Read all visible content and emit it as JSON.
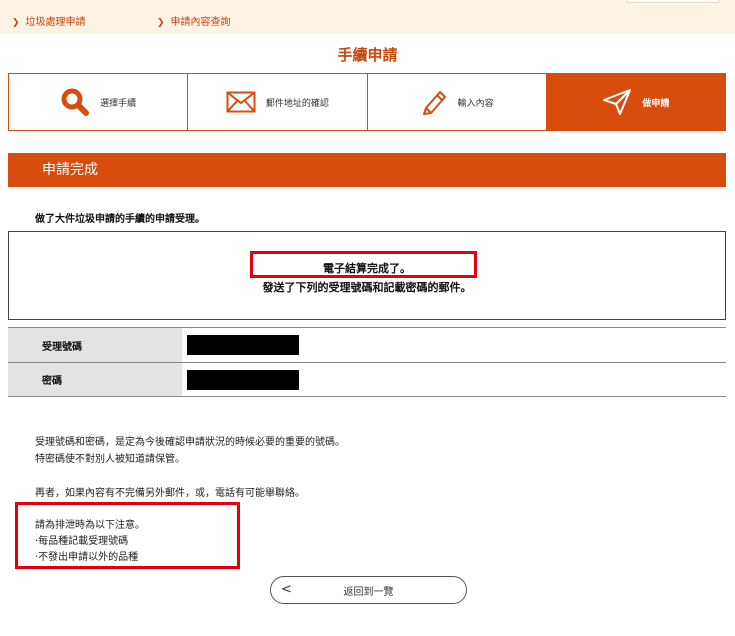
{
  "breadcrumbs": [
    {
      "label": "垃圾處理申請"
    },
    {
      "label": "申請內容查詢"
    }
  ],
  "page_title": "手續申請",
  "steps": [
    {
      "label": "選擇手續",
      "icon": "search-icon"
    },
    {
      "label": "郵件地址的確認",
      "icon": "envelope-icon"
    },
    {
      "label": "輸入內容",
      "icon": "pencil-icon"
    },
    {
      "label": "做申請",
      "icon": "send-icon",
      "active": true
    }
  ],
  "section_title": "申請完成",
  "intro": "做了大件垃圾申請的手續的申請受理。",
  "message": {
    "line1": "電子結算完成了。",
    "line2": "發送了下列的受理號碼和記載密碼的郵件。"
  },
  "table": [
    {
      "label": "受理號碼",
      "value": ""
    },
    {
      "label": "密碼",
      "value": ""
    }
  ],
  "notes": {
    "n1": "受理號碼和密碼，是定為今後確認申請狀況的時候必要的重要的號碼。",
    "n2": "特密碼使不對別人被知道請保管。",
    "n3": "再者，如果內容有不完備另外郵件，或，電話有可能舉聯絡。",
    "n4": "請為排泄時為以下注意。",
    "n5": "·每品種記載受理號碼",
    "n6": "·不發出申請以外的品種"
  },
  "back_button": {
    "label": "返回到一覽",
    "arrow": "<"
  },
  "colors": {
    "accent": "#d84c0e",
    "highlight": "#e4000f",
    "topbar": "#fdf3e4"
  }
}
